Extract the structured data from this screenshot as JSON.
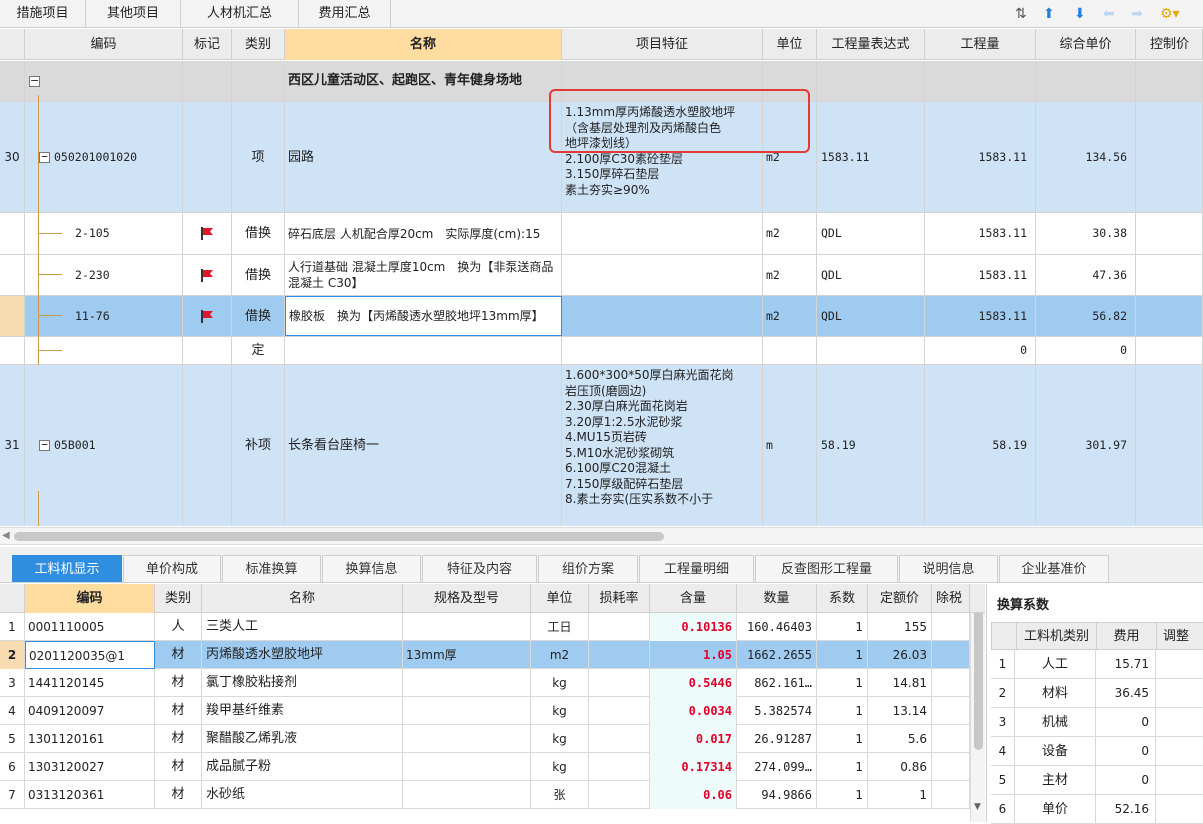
{
  "top_tabs": [
    "措施项目",
    "其他项目",
    "人材机汇总",
    "费用汇总"
  ],
  "columns": [
    "编码",
    "标记",
    "类别",
    "名称",
    "项目特征",
    "单位",
    "工程量表达式",
    "工程量",
    "综合单价",
    "控制价"
  ],
  "section_row": {
    "name": "西区儿童活动区、起跑区、青年健身场地"
  },
  "row30": {
    "num": "30",
    "code": "050201001020",
    "type": "项",
    "name": "园路",
    "features": [
      "1.13mm厚丙烯酸透水塑胶地坪",
      "（含基层处理剂及丙烯酸白色",
      "地坪漆划线）",
      "2.100厚C30素砼垫层",
      "3.150厚碎石垫层",
      "素土夯实≥90%"
    ],
    "unit": "m2",
    "expr": "1583.11",
    "qty": "1583.11",
    "price": "134.56"
  },
  "sub_rows": [
    {
      "code": "2-105",
      "type": "借换",
      "name": "碎石底层 人机配合厚20cm　实际厚度(cm):15",
      "unit": "m2",
      "expr": "QDL",
      "qty": "1583.11",
      "price": "30.38"
    },
    {
      "code": "2-230",
      "type": "借换",
      "name": "人行道基础 混凝土厚度10cm　换为【非泵送商品混凝土 C30】",
      "unit": "m2",
      "expr": "QDL",
      "qty": "1583.11",
      "price": "47.36"
    },
    {
      "code": "11-76",
      "type": "借换",
      "name": "橡胶板　换为【丙烯酸透水塑胶地坪13mm厚】",
      "unit": "m2",
      "expr": "QDL",
      "qty": "1583.11",
      "price": "56.82"
    },
    {
      "code": "",
      "type": "定",
      "name": "",
      "unit": "",
      "expr": "",
      "qty": "0",
      "price": "0"
    }
  ],
  "row31": {
    "num": "31",
    "code": "05B001",
    "type": "补项",
    "name": "长条看台座椅一",
    "features": [
      "1.600*300*50厚白麻光面花岗",
      "岩压顶(磨圆边)",
      "2.30厚白麻光面花岗岩",
      "3.20厚1:2.5水泥砂浆",
      "4.MU15页岩砖",
      "5.M10水泥砂浆砌筑",
      "6.100厚C20混凝土",
      "7.150厚级配碎石垫层",
      "8.素土夯实(压实系数不小于"
    ],
    "unit": "m",
    "expr": "58.19",
    "qty": "58.19",
    "price": "301.97"
  },
  "bottom_tabs": [
    "工料机显示",
    "单价构成",
    "标准换算",
    "换算信息",
    "特征及内容",
    "组价方案",
    "工程量明细",
    "反查图形工程量",
    "说明信息",
    "企业基准价"
  ],
  "lower_cols": [
    "编码",
    "类别",
    "名称",
    "规格及型号",
    "单位",
    "损耗率",
    "含量",
    "数量",
    "系数",
    "定额价",
    "除税"
  ],
  "lower_rows": [
    {
      "n": "1",
      "code": "0001110005",
      "cat": "人",
      "name": "三类人工",
      "spec": "",
      "unit": "工日",
      "loss": "",
      "content": "0.10136",
      "qty": "160.46403",
      "coef": "1",
      "price": "155"
    },
    {
      "n": "2",
      "code": "0201120035@1",
      "cat": "材",
      "name": "丙烯酸透水塑胶地坪",
      "spec": "13mm厚",
      "unit": "m2",
      "loss": "",
      "content": "1.05",
      "qty": "1662.2655",
      "coef": "1",
      "price": "26.03"
    },
    {
      "n": "3",
      "code": "1441120145",
      "cat": "材",
      "name": "氯丁橡胶粘接剂",
      "spec": "",
      "unit": "kg",
      "loss": "",
      "content": "0.5446",
      "qty": "862.161…",
      "coef": "1",
      "price": "14.81"
    },
    {
      "n": "4",
      "code": "0409120097",
      "cat": "材",
      "name": "羧甲基纤维素",
      "spec": "",
      "unit": "kg",
      "loss": "",
      "content": "0.0034",
      "qty": "5.382574",
      "coef": "1",
      "price": "13.14"
    },
    {
      "n": "5",
      "code": "1301120161",
      "cat": "材",
      "name": "聚醋酸乙烯乳液",
      "spec": "",
      "unit": "kg",
      "loss": "",
      "content": "0.017",
      "qty": "26.91287",
      "coef": "1",
      "price": "5.6"
    },
    {
      "n": "6",
      "code": "1303120027",
      "cat": "材",
      "name": "成品腻子粉",
      "spec": "",
      "unit": "kg",
      "loss": "",
      "content": "0.17314",
      "qty": "274.099…",
      "coef": "1",
      "price": "0.86"
    },
    {
      "n": "7",
      "code": "0313120361",
      "cat": "材",
      "name": "水砂纸",
      "spec": "",
      "unit": "张",
      "loss": "",
      "content": "0.06",
      "qty": "94.9866",
      "coef": "1",
      "price": "1"
    }
  ],
  "calc_panel": {
    "title": "换算系数",
    "cols": [
      "工料机类别",
      "费用",
      "调整"
    ],
    "rows": [
      {
        "n": "1",
        "cat": "人工",
        "fee": "15.71"
      },
      {
        "n": "2",
        "cat": "材料",
        "fee": "36.45"
      },
      {
        "n": "3",
        "cat": "机械",
        "fee": "0"
      },
      {
        "n": "4",
        "cat": "设备",
        "fee": "0"
      },
      {
        "n": "5",
        "cat": "主材",
        "fee": "0"
      },
      {
        "n": "6",
        "cat": "单价",
        "fee": "52.16"
      }
    ]
  },
  "colors": {
    "accent": "#2f8ee0",
    "highlight_row": "#cfe3f7",
    "selected_row": "#9fcbf1",
    "red_box": "#e53935",
    "flag": "#e0182d"
  }
}
